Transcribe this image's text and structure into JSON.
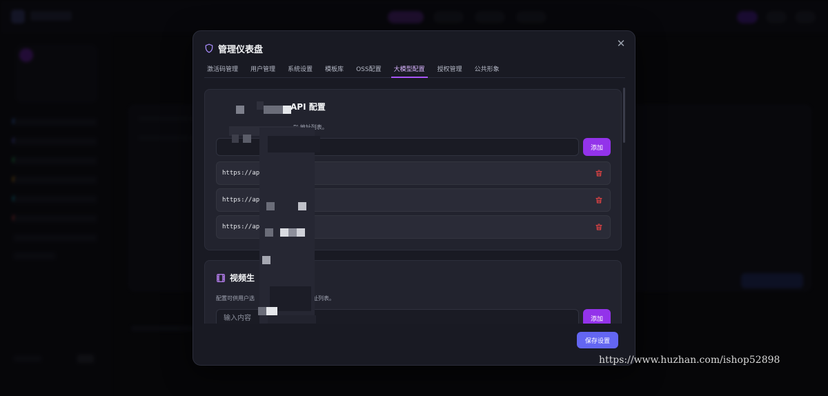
{
  "modal": {
    "title": "管理仪表盘",
    "close_label": "✕",
    "tabs": [
      {
        "label": "激活码管理",
        "active": false
      },
      {
        "label": "用户管理",
        "active": false
      },
      {
        "label": "系统设置",
        "active": false
      },
      {
        "label": "模板库",
        "active": false
      },
      {
        "label": "OSS配置",
        "active": false
      },
      {
        "label": "大模型配置",
        "active": true
      },
      {
        "label": "授权管理",
        "active": false
      },
      {
        "label": "公共形象",
        "active": false
      }
    ],
    "save_label": "保存设置"
  },
  "api_section": {
    "title": "API 配置",
    "description": "PI 地址列表。",
    "input_value": "",
    "input_placeholder": "",
    "add_label": "添加",
    "urls": [
      "https://ap",
      "https://ap",
      "https://ap"
    ]
  },
  "video_section": {
    "title": "视频生",
    "description_start": "配置可供用户选",
    "description_end": "址列表。",
    "input_placeholder": "输入内容",
    "add_label": "添加"
  },
  "watermark": "https://www.huzhan.com/ishop52898",
  "colors": {
    "accent_purple": "#9333ea",
    "tab_active": "#a855f7",
    "save_button": "#6366f1",
    "trash_red": "#ef4444"
  },
  "icons": {
    "header": "shield-icon",
    "close": "close-icon",
    "url_delete": "trash-icon",
    "video_section": "film-icon"
  }
}
